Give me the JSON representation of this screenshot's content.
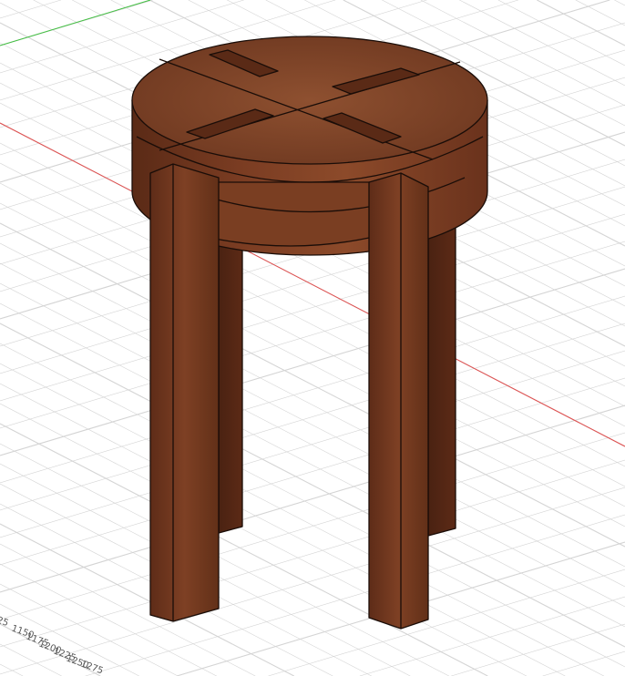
{
  "viewport": {
    "model": "round-stool",
    "axis_colors": {
      "x": "#e05050",
      "y": "#40c040"
    },
    "grid_color": "#d4d4d4",
    "wood_colors": {
      "light": "#8a4a2a",
      "mid": "#6e3520",
      "dark": "#4a2212",
      "outline": "#1a0d08"
    }
  },
  "ruler": {
    "ticks": [
      "25",
      "1150",
      "1175",
      "1200",
      "1225",
      "1250",
      "1275"
    ]
  }
}
